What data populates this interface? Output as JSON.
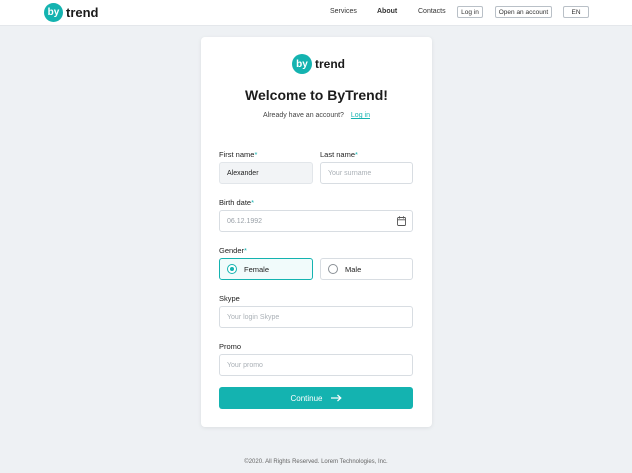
{
  "brand": {
    "circle_text": "by",
    "word": "trend",
    "accent": "#14b3b0"
  },
  "nav": {
    "services": "Services",
    "about": "About",
    "contacts": "Contacts",
    "login": "Log in",
    "open_account": "Open an account",
    "language": "EN"
  },
  "card": {
    "title": "Welcome to ByTrend!",
    "subline": "Already have an account?",
    "login_link": "Log in"
  },
  "form": {
    "first_name": {
      "label": "First name",
      "value": "Alexander"
    },
    "last_name": {
      "label": "Last name",
      "placeholder": "Your surname"
    },
    "birth_date": {
      "label": "Birth date",
      "placeholder": "06.12.1992"
    },
    "gender": {
      "label": "Gender",
      "options": [
        "Female",
        "Male"
      ],
      "selected": "Female"
    },
    "skype": {
      "label": "Skype",
      "placeholder": "Your login Skype"
    },
    "promo": {
      "label": "Promo",
      "placeholder": "Your promo"
    },
    "required_mark": "*",
    "submit": "Continue"
  },
  "footer": {
    "text": "©2020. All Rights Reserved. Lorem Technologies, Inc."
  }
}
